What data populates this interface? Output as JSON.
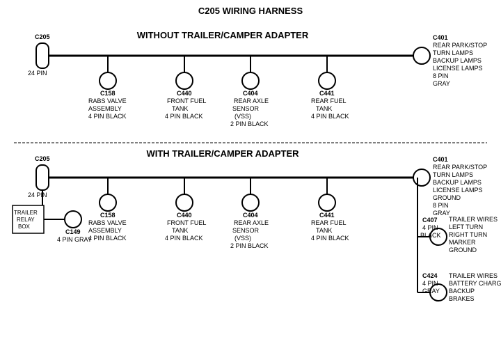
{
  "title": "C205 WIRING HARNESS",
  "top_section": {
    "label": "WITHOUT TRAILER/CAMPER ADAPTER",
    "left_connector": {
      "name": "C205",
      "pins": "24 PIN"
    },
    "right_connector": {
      "name": "C401",
      "pins": "8 PIN",
      "color": "GRAY",
      "desc": "REAR PARK/STOP\nTURN LAMPS\nBACKUP LAMPS\nLICENSE LAMPS"
    },
    "connectors": [
      {
        "name": "C158",
        "desc": "RABS VALVE\nASSEMBLY\n4 PIN BLACK"
      },
      {
        "name": "C440",
        "desc": "FRONT FUEL\nTANK\n4 PIN BLACK"
      },
      {
        "name": "C404",
        "desc": "REAR AXLE\nSENSOR\n(VSS)\n2 PIN BLACK"
      },
      {
        "name": "C441",
        "desc": "REAR FUEL\nTANK\n4 PIN BLACK"
      }
    ]
  },
  "bottom_section": {
    "label": "WITH TRAILER/CAMPER ADAPTER",
    "left_connector": {
      "name": "C205",
      "pins": "24 PIN"
    },
    "right_connector": {
      "name": "C401",
      "pins": "8 PIN",
      "color": "GRAY",
      "desc": "REAR PARK/STOP\nTURN LAMPS\nBACKUP LAMPS\nLICENSE LAMPS\nGROUND"
    },
    "extra_left": {
      "name": "C149",
      "pins": "4 PIN GRAY",
      "box": "TRAILER\nRELAY\nBOX"
    },
    "connectors": [
      {
        "name": "C158",
        "desc": "RABS VALVE\nASSEMBLY\n4 PIN BLACK"
      },
      {
        "name": "C440",
        "desc": "FRONT FUEL\nTANK\n4 PIN BLACK"
      },
      {
        "name": "C404",
        "desc": "REAR AXLE\nSENSOR\n(VSS)\n2 PIN BLACK"
      },
      {
        "name": "C441",
        "desc": "REAR FUEL\nTANK\n4 PIN BLACK"
      }
    ],
    "right_extra": [
      {
        "name": "C407",
        "pins": "4 PIN",
        "color": "BLACK",
        "desc": "TRAILER WIRES\nLEFT TURN\nRIGHT TURN\nMARKER\nGROUND"
      },
      {
        "name": "C424",
        "pins": "4 PIN",
        "color": "GRAY",
        "desc": "TRAILER WIRES\nBATTERY CHARGE\nBACKUP\nBRAKES"
      }
    ]
  }
}
